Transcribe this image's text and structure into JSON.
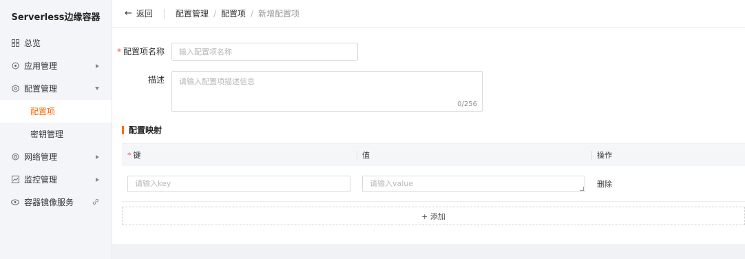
{
  "sidebar": {
    "brand": "Serverless边缘容器",
    "items": [
      {
        "label": "总览",
        "icon": "dashboard-icon"
      },
      {
        "label": "应用管理",
        "icon": "app-icon"
      },
      {
        "label": "配置管理",
        "icon": "config-icon"
      },
      {
        "label": "网络管理",
        "icon": "network-icon"
      },
      {
        "label": "监控管理",
        "icon": "monitor-icon"
      },
      {
        "label": "容器镜像服务",
        "icon": "image-icon"
      }
    ],
    "sub_items": [
      {
        "label": "配置项",
        "active": true
      },
      {
        "label": "密钥管理",
        "active": false
      }
    ]
  },
  "header": {
    "back_label": "返回",
    "breadcrumb": [
      "配置管理",
      "配置项",
      "新增配置项"
    ],
    "separator": "/"
  },
  "form": {
    "name_label": "配置项名称",
    "name_placeholder": "输入配置项名称",
    "desc_label": "描述",
    "desc_placeholder": "请输入配置项描述信息",
    "desc_counter": "0/256"
  },
  "mapping": {
    "title": "配置映射",
    "columns": [
      "键",
      "值",
      "操作"
    ],
    "key_placeholder": "请输入key",
    "value_placeholder": "请输入value",
    "delete_label": "删除",
    "add_label": "+ 添加"
  },
  "colors": {
    "accent": "#ff6a00",
    "required": "#ff4d4f"
  }
}
